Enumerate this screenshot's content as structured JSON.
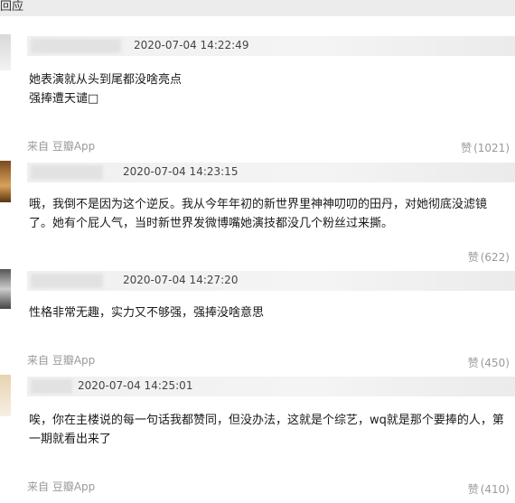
{
  "top_label": "回应",
  "comments": [
    {
      "time": "2020-07-04 14:22:49",
      "text_lines": [
        "她表演就从头到尾都没啥亮点",
        "强捧遭天谴□"
      ],
      "source": "来自 豆瓣App",
      "like_label": "赞",
      "like_count": "(1021)"
    },
    {
      "time": "2020-07-04 14:23:15",
      "text_lines": [
        "哦，我倒不是因为这个逆反。我从今年年初的新世界里神神叨叨的田丹，对她彻底没滤镜",
        "了。她有个屁人气，当时新世界发微博嘴她演技都没几个粉丝过来撕。"
      ],
      "source": "",
      "like_label": "赞",
      "like_count": "(622)"
    },
    {
      "time": "2020-07-04 14:27:20",
      "text_lines": [
        "性格非常无趣，实力又不够强，强捧没啥意思"
      ],
      "source": "来自 豆瓣App",
      "like_label": "赞",
      "like_count": "(450)"
    },
    {
      "time": "2020-07-04 14:25:01",
      "text_lines": [
        "唉，你在主楼说的每一句话我都赞同，但没办法，这就是个综艺，wq就是那个要捧的人，第",
        "一期就看出来了"
      ],
      "source": "来自 豆瓣App",
      "like_label": "赞",
      "like_count": "(410)"
    }
  ]
}
